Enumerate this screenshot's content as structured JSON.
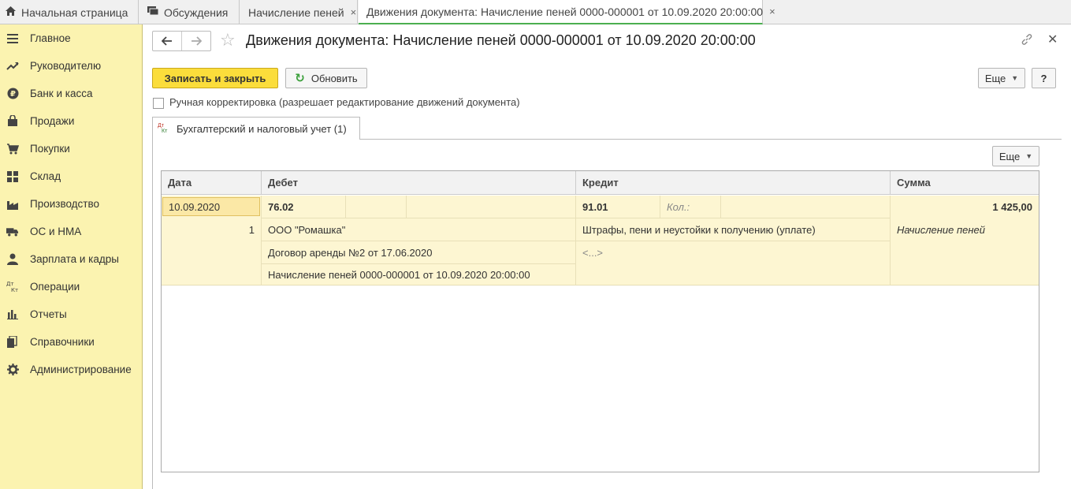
{
  "tabs": [
    {
      "label": "Начальная страница",
      "icon": "home-icon"
    },
    {
      "label": "Обсуждения",
      "icon": "chat-icon"
    },
    {
      "label": "Начисление пеней",
      "close": "×"
    },
    {
      "label": "Движения документа: Начисление пеней 0000-000001 от 10.09.2020 20:00:00",
      "close": "×"
    }
  ],
  "sidebar": {
    "items": [
      {
        "label": "Главное",
        "icon": "menu-icon"
      },
      {
        "label": "Руководителю",
        "icon": "trend-icon"
      },
      {
        "label": "Банк и касса",
        "icon": "ruble-icon"
      },
      {
        "label": "Продажи",
        "icon": "bag-icon"
      },
      {
        "label": "Покупки",
        "icon": "cart-icon"
      },
      {
        "label": "Склад",
        "icon": "grid-icon"
      },
      {
        "label": "Производство",
        "icon": "factory-icon"
      },
      {
        "label": "ОС и НМА",
        "icon": "truck-icon"
      },
      {
        "label": "Зарплата и кадры",
        "icon": "person-icon"
      },
      {
        "label": "Операции",
        "icon": "dt-kt-icon"
      },
      {
        "label": "Отчеты",
        "icon": "bar-chart-icon"
      },
      {
        "label": "Справочники",
        "icon": "books-icon"
      },
      {
        "label": "Администрирование",
        "icon": "gear-icon"
      }
    ]
  },
  "header": {
    "title": "Движения документа: Начисление пеней 0000-000001 от 10.09.2020 20:00:00"
  },
  "toolbar": {
    "save_close": "Записать и закрыть",
    "refresh": "Обновить",
    "more": "Еще",
    "help": "?"
  },
  "manual_edit": {
    "label": "Ручная корректировка (разрешает редактирование движений документа)",
    "checked": false
  },
  "tab_panel": {
    "tab_label": "Бухгалтерский и налоговый учет (1)",
    "tab_icon_top": "Дт",
    "tab_icon_bottom": "Кт",
    "more": "Еще"
  },
  "table": {
    "columns": [
      "Дата",
      "Дебет",
      "Кредит",
      "Сумма"
    ],
    "rows": [
      {
        "date": "10.09.2020",
        "line_no": "1",
        "debit_account": "76.02",
        "debit_sub1": "ООО \"Ромашка\"",
        "debit_sub2": "Договор аренды №2 от 17.06.2020",
        "debit_sub3": "Начисление пеней 0000-000001 от 10.09.2020 20:00:00",
        "credit_account": "91.01",
        "credit_qty_label": "Кол.:",
        "credit_sub1": "Штрафы, пени и неустойки к получению (уплате)",
        "credit_sub2": "<...>",
        "amount": "1 425,00",
        "content": "Начисление пеней"
      }
    ]
  }
}
